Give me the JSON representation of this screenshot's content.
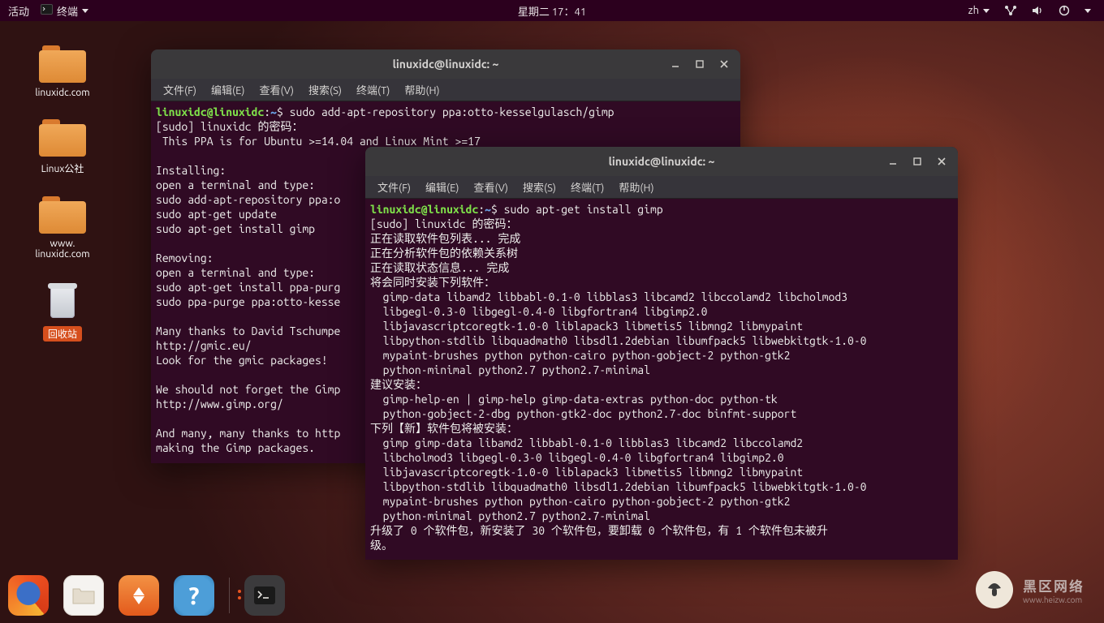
{
  "topbar": {
    "activities": "活动",
    "app_label": "终端",
    "clock": "星期二 17：41",
    "input_method": "zh"
  },
  "desktop": {
    "icons": [
      {
        "label": "linuxidc.com"
      },
      {
        "label": "Linux公社"
      },
      {
        "label": "www.\nlinuxidc.com"
      },
      {
        "label": "回收站"
      }
    ]
  },
  "terminal1": {
    "title": "linuxidc@linuxidc: ~",
    "menus": [
      "文件(F)",
      "编辑(E)",
      "查看(V)",
      "搜索(S)",
      "终端(T)",
      "帮助(H)"
    ],
    "prompt_user": "linuxidc@linuxidc",
    "prompt_path": "~",
    "command": "sudo add-apt-repository ppa:otto-kesselgulasch/gimp",
    "output": "[sudo] linuxidc 的密码：\n This PPA is for Ubuntu >=14.04 and Linux Mint >=17\n\nInstalling:\nopen a terminal and type:\nsudo add-apt-repository ppa:o\nsudo apt-get update\nsudo apt-get install gimp\n\nRemoving:\nopen a terminal and type:\nsudo apt-get install ppa-purg\nsudo ppa-purge ppa:otto-kesse\n\nMany thanks to David Tschumpe\nhttp://gmic.eu/\nLook for the gmic packages!\n\nWe should not forget the Gimp\nhttp://www.gimp.org/\n\nAnd many, many thanks to http\nmaking the Gimp packages."
  },
  "terminal2": {
    "title": "linuxidc@linuxidc: ~",
    "menus": [
      "文件(F)",
      "编辑(E)",
      "查看(V)",
      "搜索(S)",
      "终端(T)",
      "帮助(H)"
    ],
    "prompt_user": "linuxidc@linuxidc",
    "prompt_path": "~",
    "command": "sudo apt-get install gimp",
    "output": "[sudo] linuxidc 的密码：\n正在读取软件包列表... 完成\n正在分析软件包的依赖关系树\n正在读取状态信息... 完成\n将会同时安装下列软件：\n  gimp-data libamd2 libbabl-0.1-0 libblas3 libcamd2 libccolamd2 libcholmod3\n  libgegl-0.3-0 libgegl-0.4-0 libgfortran4 libgimp2.0\n  libjavascriptcoregtk-1.0-0 liblapack3 libmetis5 libmng2 libmypaint\n  libpython-stdlib libquadmath0 libsdl1.2debian libumfpack5 libwebkitgtk-1.0-0\n  mypaint-brushes python python-cairo python-gobject-2 python-gtk2\n  python-minimal python2.7 python2.7-minimal\n建议安装：\n  gimp-help-en | gimp-help gimp-data-extras python-doc python-tk\n  python-gobject-2-dbg python-gtk2-doc python2.7-doc binfmt-support\n下列【新】软件包将被安装：\n  gimp gimp-data libamd2 libbabl-0.1-0 libblas3 libcamd2 libccolamd2\n  libcholmod3 libgegl-0.3-0 libgegl-0.4-0 libgfortran4 libgimp2.0\n  libjavascriptcoregtk-1.0-0 liblapack3 libmetis5 libmng2 libmypaint\n  libpython-stdlib libquadmath0 libsdl1.2debian libumfpack5 libwebkitgtk-1.0-0\n  mypaint-brushes python python-cairo python-gobject-2 python-gtk2\n  python-minimal python2.7 python2.7-minimal\n升级了 0 个软件包，新安装了 30 个软件包，要卸载 0 个软件包，有 1 个软件包未被升\n级。"
  },
  "watermark": {
    "text": "黑区网络",
    "url": "www.heizw.com"
  }
}
